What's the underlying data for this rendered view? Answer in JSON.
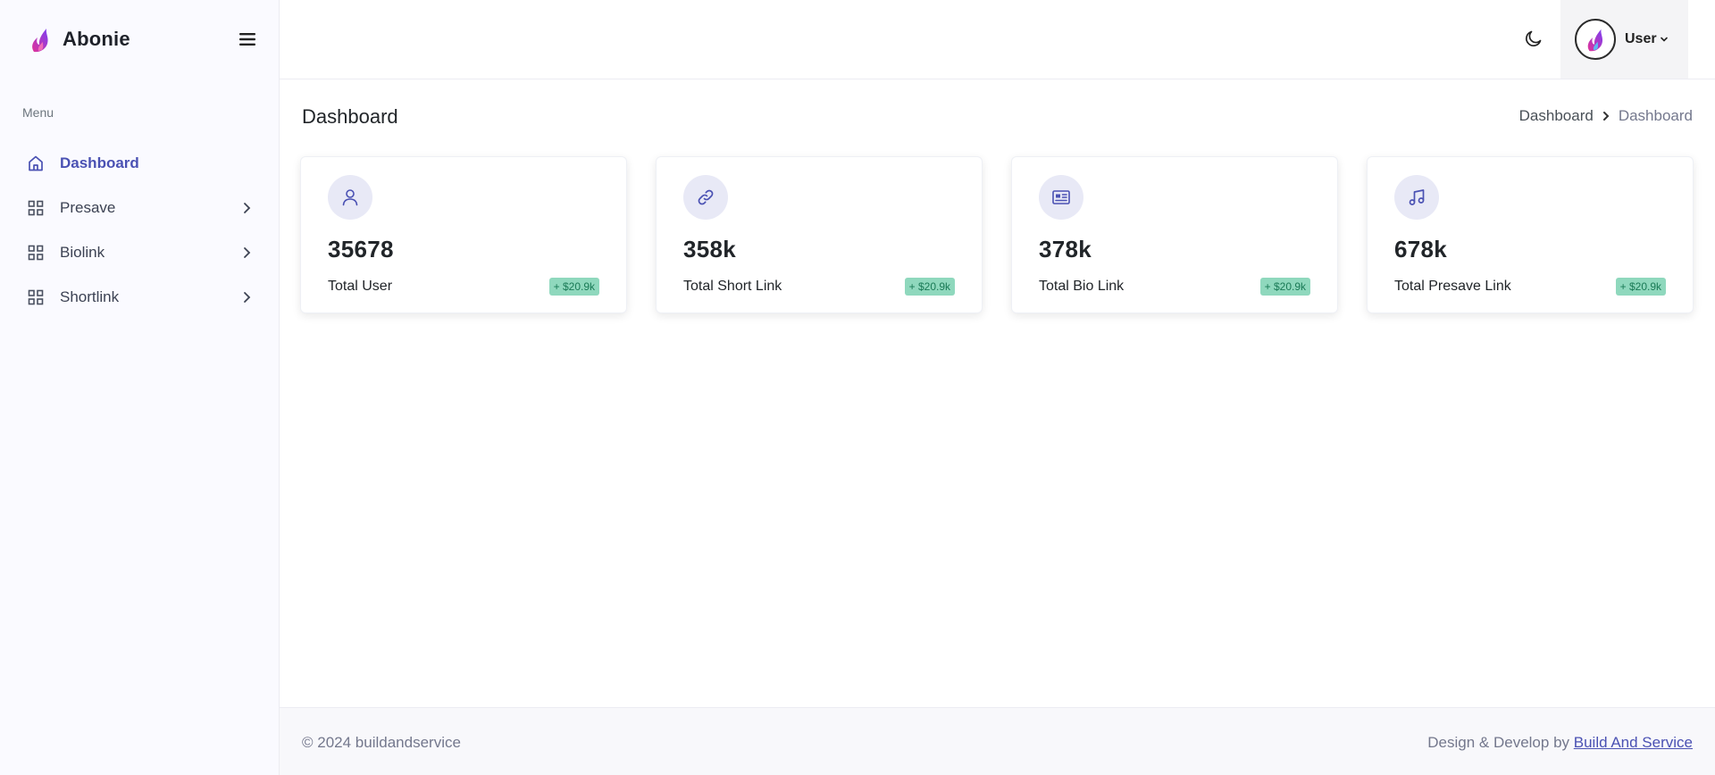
{
  "brand": {
    "name": "Abonie",
    "logo_icon": "flame-logo-icon"
  },
  "sidebar": {
    "menu_title": "Menu",
    "items": [
      {
        "label": "Dashboard",
        "icon": "home-icon",
        "active": true,
        "has_submenu": false
      },
      {
        "label": "Presave",
        "icon": "grid-icon",
        "active": false,
        "has_submenu": true
      },
      {
        "label": "Biolink",
        "icon": "grid-icon",
        "active": false,
        "has_submenu": true
      },
      {
        "label": "Shortlink",
        "icon": "grid-icon",
        "active": false,
        "has_submenu": true
      }
    ]
  },
  "topbar": {
    "theme_icon": "moon-icon",
    "user": {
      "name": "User",
      "caret_icon": "chevron-down-icon"
    }
  },
  "page": {
    "title": "Dashboard",
    "breadcrumb": {
      "link": "Dashboard",
      "current": "Dashboard"
    }
  },
  "cards": [
    {
      "value": "35678",
      "label": "Total User",
      "badge": "+ $20.9k",
      "icon": "user-icon"
    },
    {
      "value": "358k",
      "label": "Total Short Link",
      "badge": "+ $20.9k",
      "icon": "link-icon"
    },
    {
      "value": "378k",
      "label": "Total Bio Link",
      "badge": "+ $20.9k",
      "icon": "newspaper-icon"
    },
    {
      "value": "678k",
      "label": "Total Presave Link",
      "badge": "+ $20.9k",
      "icon": "music-icon"
    }
  ],
  "footer": {
    "copyright": "© 2024 buildandservice",
    "credit_prefix": "Design & Develop by ",
    "credit_link": "Build And Service"
  },
  "colors": {
    "accent": "#4a51b3",
    "sidebar_bg": "#fafaff",
    "badge_bg": "#8fd8bd",
    "badge_text": "#1a7a56",
    "icon_circle_bg": "#e8e9f6"
  }
}
